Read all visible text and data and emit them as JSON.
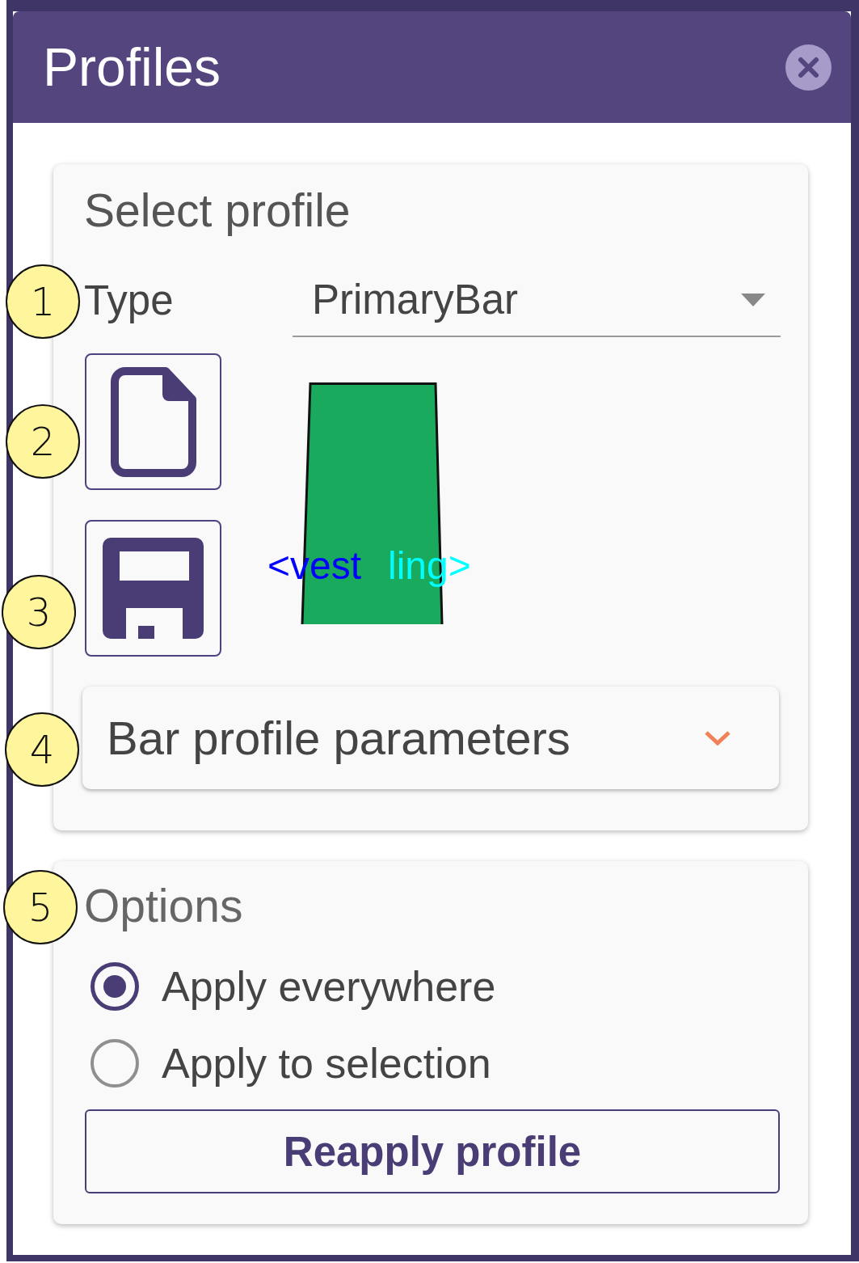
{
  "window": {
    "title": "Profiles"
  },
  "select_profile": {
    "title": "Select profile",
    "type_label": "Type",
    "type_select": {
      "value": "PrimaryBar"
    },
    "preview": {
      "labels": [
        {
          "text": "<vest",
          "color": "#0000ff"
        },
        {
          "text": "ling>",
          "color": "#00ffff"
        }
      ]
    },
    "parameters": {
      "title": "Bar profile parameters",
      "expanded": false
    }
  },
  "options": {
    "title": "Options",
    "radios": [
      {
        "label": "Apply everywhere",
        "selected": true
      },
      {
        "label": "Apply to selection",
        "selected": false
      }
    ],
    "button": "Reapply profile"
  },
  "callouts": [
    "1",
    "2",
    "3",
    "4",
    "5"
  ]
}
